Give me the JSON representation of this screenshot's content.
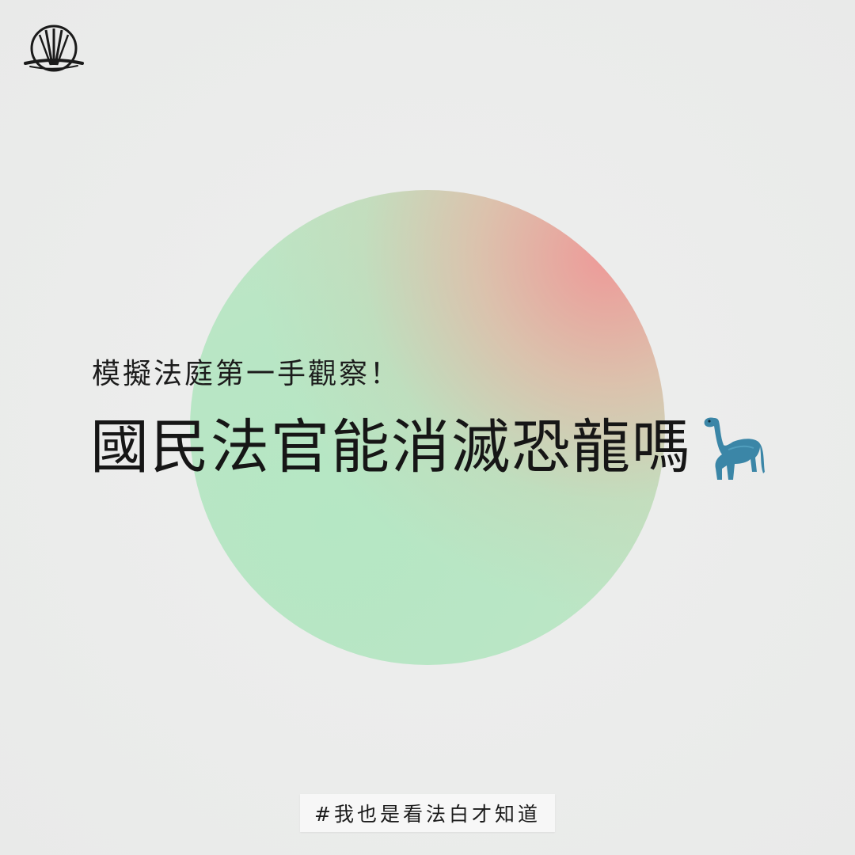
{
  "subtitle": "模擬法庭第一手觀察！",
  "headline": "國民法官能消滅恐龍嗎",
  "hashtag": "#我也是看法白才知道",
  "icons": {
    "logo": "brand-logo-icon",
    "dinosaur": "sauropod-dinosaur-icon"
  },
  "colors": {
    "background": "#ecedec",
    "circle_green": "#b5e7c4",
    "circle_pink": "#f09696",
    "text": "#161616",
    "dinosaur": "#3b86a7"
  }
}
